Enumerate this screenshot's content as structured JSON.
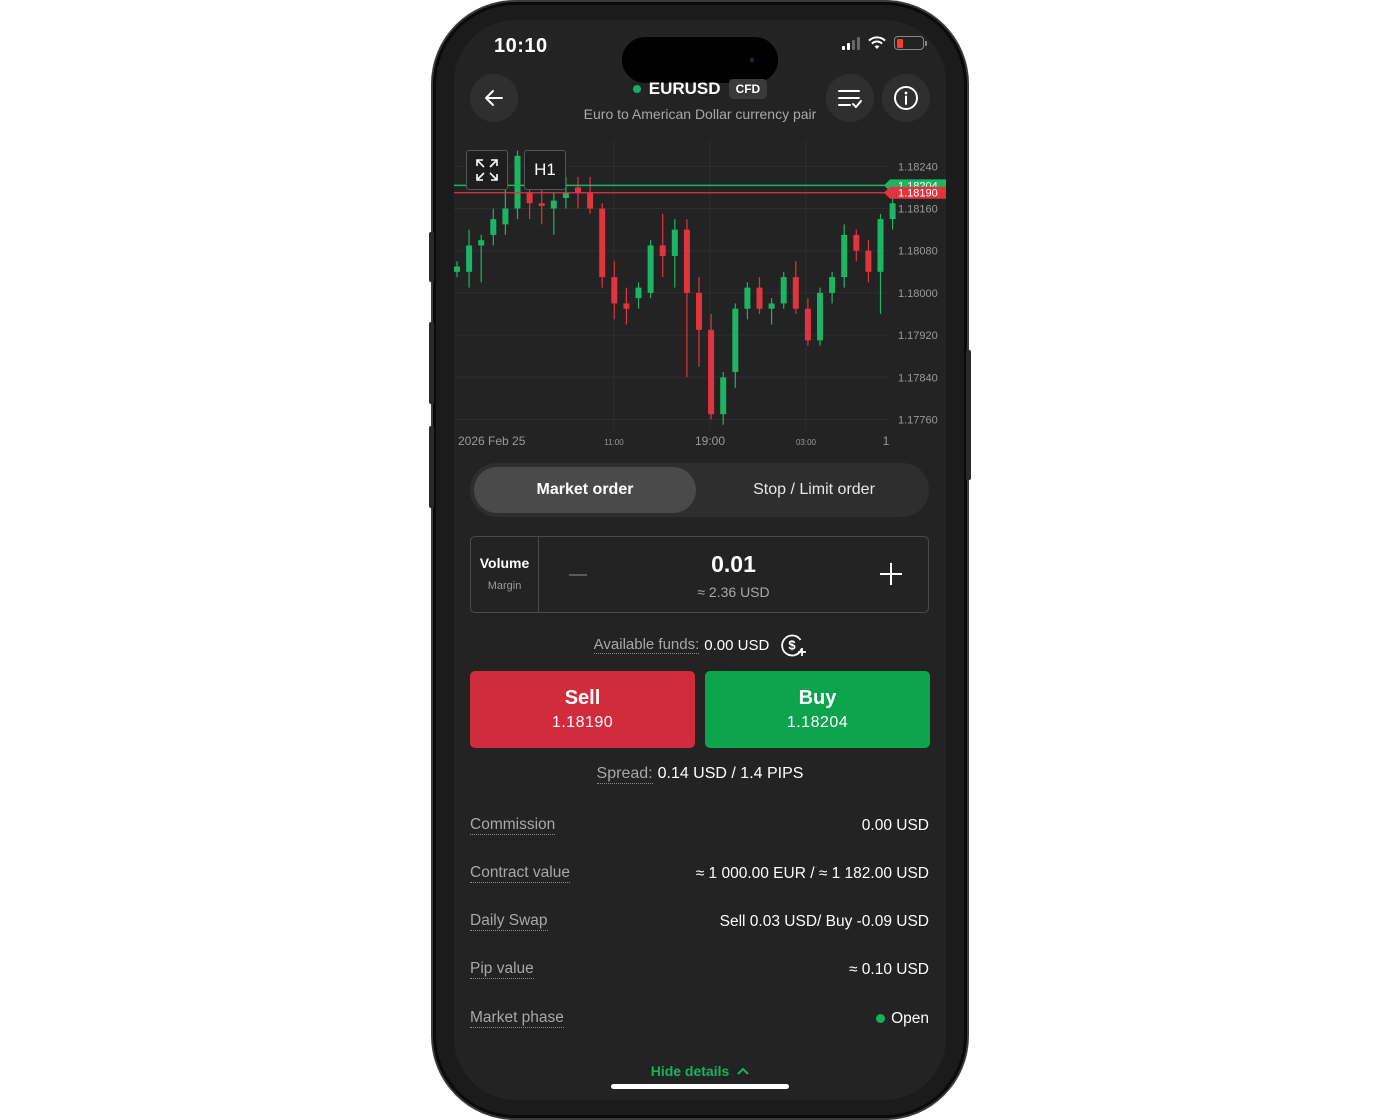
{
  "status_bar": {
    "time": "10:10"
  },
  "header": {
    "symbol": "EURUSD",
    "badge": "CFD",
    "description": "Euro to American Dollar currency pair",
    "back_icon": "arrow-left-icon",
    "orders_icon": "list-check-icon",
    "info_icon": "info-circle-icon"
  },
  "chart_data": {
    "type": "candlestick",
    "timeframe": "H1",
    "y_ticks": [
      "1.18240",
      "1.18160",
      "1.18080",
      "1.18000",
      "1.17920",
      "1.17840",
      "1.17760"
    ],
    "x_ticks": [
      "2026 Feb 25",
      "11:00",
      "19:00",
      "03:00",
      "1"
    ],
    "ylim": [
      1.1774,
      1.1829
    ],
    "buy_price": 1.18204,
    "sell_price": 1.1819,
    "buy_price_label": "1.18204",
    "sell_price_label": "1.18190",
    "grid": true,
    "colors": {
      "up": "#1db463",
      "down": "#e0343f",
      "background": "#232323"
    },
    "candles": [
      {
        "o": 1.1804,
        "h": 1.1806,
        "l": 1.1803,
        "c": 1.1805
      },
      {
        "o": 1.1804,
        "h": 1.1812,
        "l": 1.1801,
        "c": 1.1809
      },
      {
        "o": 1.1809,
        "h": 1.1811,
        "l": 1.1802,
        "c": 1.181
      },
      {
        "o": 1.1811,
        "h": 1.1816,
        "l": 1.1809,
        "c": 1.1814
      },
      {
        "o": 1.1813,
        "h": 1.182,
        "l": 1.1811,
        "c": 1.1816
      },
      {
        "o": 1.1816,
        "h": 1.1827,
        "l": 1.1814,
        "c": 1.1826
      },
      {
        "o": 1.1819,
        "h": 1.1822,
        "l": 1.1814,
        "c": 1.1817
      },
      {
        "o": 1.1817,
        "h": 1.1821,
        "l": 1.1813,
        "c": 1.18165
      },
      {
        "o": 1.1816,
        "h": 1.1819,
        "l": 1.1811,
        "c": 1.18175
      },
      {
        "o": 1.1818,
        "h": 1.1822,
        "l": 1.1816,
        "c": 1.1819
      },
      {
        "o": 1.182,
        "h": 1.1822,
        "l": 1.1816,
        "c": 1.1819
      },
      {
        "o": 1.1819,
        "h": 1.1822,
        "l": 1.1815,
        "c": 1.1816
      },
      {
        "o": 1.1816,
        "h": 1.1817,
        "l": 1.1801,
        "c": 1.1803
      },
      {
        "o": 1.1803,
        "h": 1.1806,
        "l": 1.1795,
        "c": 1.1798
      },
      {
        "o": 1.1798,
        "h": 1.1801,
        "l": 1.1794,
        "c": 1.1797
      },
      {
        "o": 1.1799,
        "h": 1.1802,
        "l": 1.1797,
        "c": 1.1801
      },
      {
        "o": 1.18,
        "h": 1.181,
        "l": 1.1799,
        "c": 1.1809
      },
      {
        "o": 1.1809,
        "h": 1.1815,
        "l": 1.1803,
        "c": 1.1807
      },
      {
        "o": 1.1807,
        "h": 1.1814,
        "l": 1.1801,
        "c": 1.1812
      },
      {
        "o": 1.1812,
        "h": 1.1814,
        "l": 1.1784,
        "c": 1.18
      },
      {
        "o": 1.18,
        "h": 1.1803,
        "l": 1.1786,
        "c": 1.1793
      },
      {
        "o": 1.1793,
        "h": 1.1796,
        "l": 1.1776,
        "c": 1.1777
      },
      {
        "o": 1.1777,
        "h": 1.1785,
        "l": 1.1775,
        "c": 1.1784
      },
      {
        "o": 1.1785,
        "h": 1.1798,
        "l": 1.1782,
        "c": 1.1797
      },
      {
        "o": 1.1797,
        "h": 1.1802,
        "l": 1.1795,
        "c": 1.1801
      },
      {
        "o": 1.1801,
        "h": 1.1803,
        "l": 1.1796,
        "c": 1.1797
      },
      {
        "o": 1.1797,
        "h": 1.1799,
        "l": 1.1794,
        "c": 1.1798
      },
      {
        "o": 1.1798,
        "h": 1.1804,
        "l": 1.1797,
        "c": 1.1803
      },
      {
        "o": 1.1803,
        "h": 1.1806,
        "l": 1.1796,
        "c": 1.1797
      },
      {
        "o": 1.1797,
        "h": 1.1799,
        "l": 1.179,
        "c": 1.1791
      },
      {
        "o": 1.1791,
        "h": 1.1801,
        "l": 1.179,
        "c": 1.18
      },
      {
        "o": 1.18,
        "h": 1.1804,
        "l": 1.1798,
        "c": 1.1803
      },
      {
        "o": 1.1803,
        "h": 1.1813,
        "l": 1.1801,
        "c": 1.1811
      },
      {
        "o": 1.1811,
        "h": 1.1812,
        "l": 1.1806,
        "c": 1.1808
      },
      {
        "o": 1.1808,
        "h": 1.181,
        "l": 1.1802,
        "c": 1.1804
      },
      {
        "o": 1.1804,
        "h": 1.1815,
        "l": 1.1796,
        "c": 1.1814
      },
      {
        "o": 1.1814,
        "h": 1.182,
        "l": 1.1812,
        "c": 1.1817
      }
    ]
  },
  "order_tabs": [
    {
      "label": "Market order",
      "active": true
    },
    {
      "label": "Stop / Limit order",
      "active": false
    }
  ],
  "volume": {
    "label": "Volume",
    "sub_label": "Margin",
    "value": "0.01",
    "margin": "≈ 2.36 USD"
  },
  "funds": {
    "label": "Available funds:",
    "value": "0.00 USD",
    "icon": "dollar-plus-icon"
  },
  "sell": {
    "label": "Sell",
    "price": "1.18190",
    "color": "#d12c3c"
  },
  "buy": {
    "label": "Buy",
    "price": "1.18204",
    "color": "#0ea44e"
  },
  "spread": {
    "label": "Spread:",
    "value": "0.14 USD / 1.4 PIPS"
  },
  "details": [
    {
      "key": "Commission",
      "value": "0.00 USD"
    },
    {
      "key": "Contract value",
      "value": "≈ 1 000.00 EUR / ≈ 1 182.00 USD"
    },
    {
      "key": "Daily Swap",
      "value": "Sell 0.03 USD/ Buy -0.09 USD"
    },
    {
      "key": "Pip value",
      "value": "≈ 0.10 USD"
    },
    {
      "key": "Market phase",
      "value": "Open"
    }
  ],
  "hide_details": "Hide details",
  "accent_color": "#14b25f"
}
